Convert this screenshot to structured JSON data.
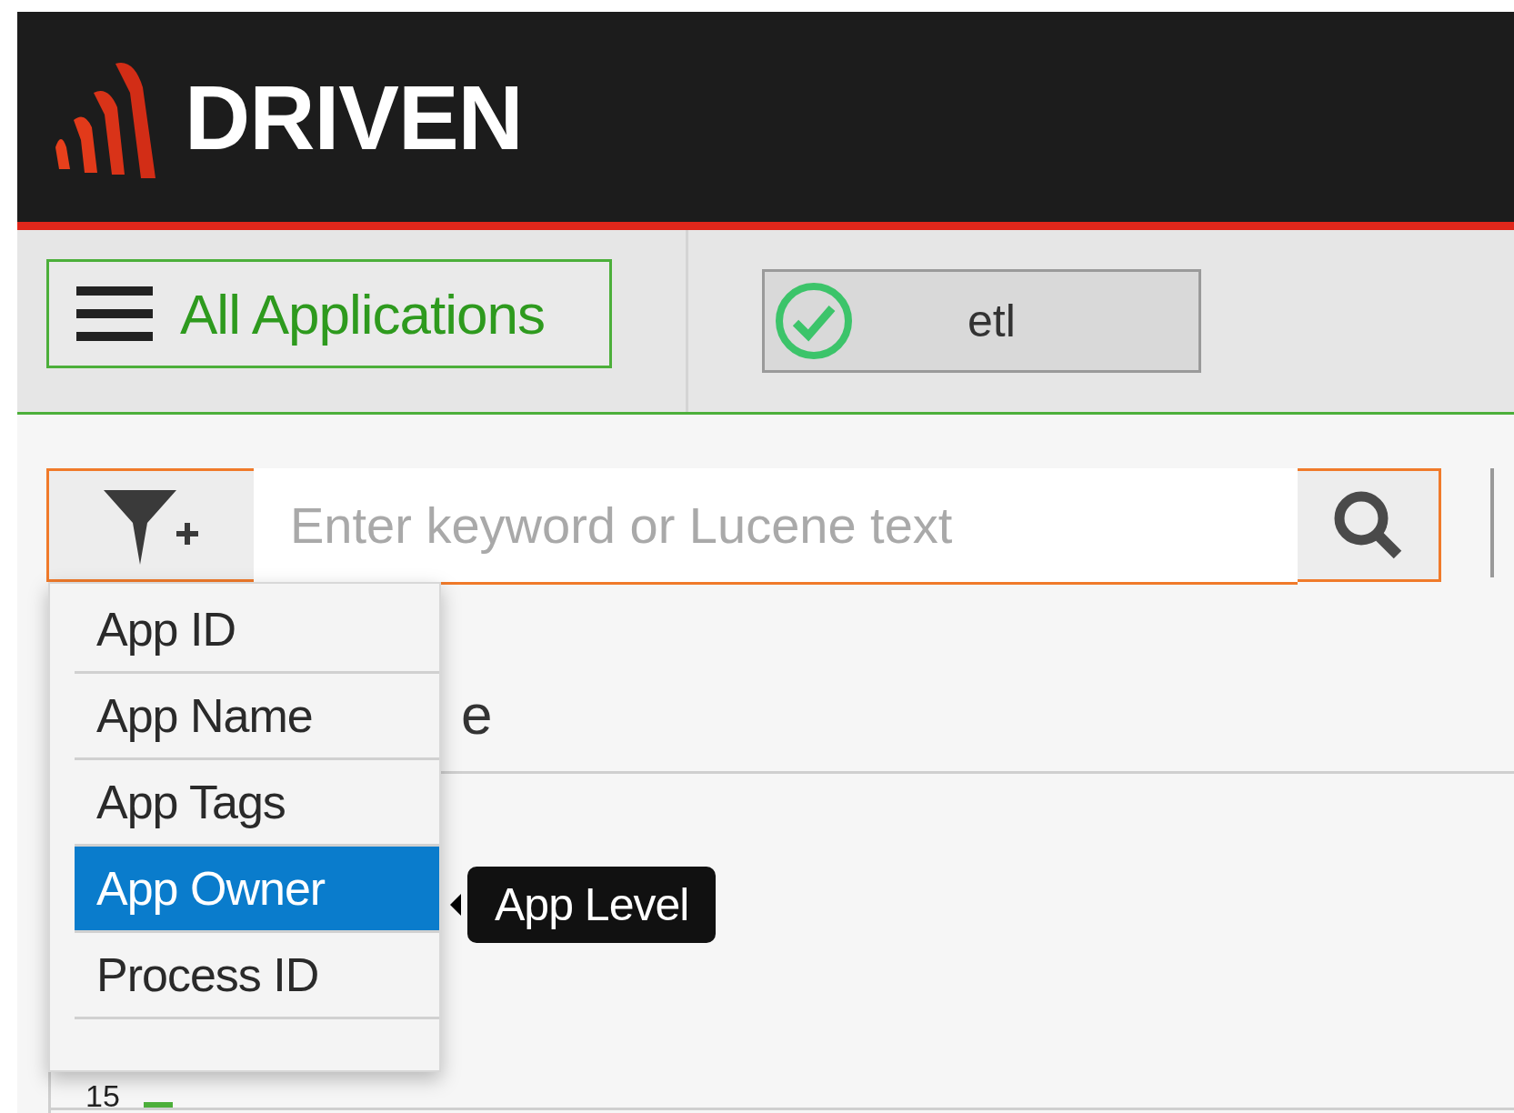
{
  "header": {
    "logo_text": "DRIVEN"
  },
  "toolbar": {
    "all_apps_button": {
      "label": "All Applications"
    },
    "status_chip": {
      "label": "etl"
    }
  },
  "search": {
    "placeholder": "Enter keyword or Lucene text"
  },
  "filter_menu": {
    "items": [
      {
        "label": "App ID",
        "selected": false
      },
      {
        "label": "App Name",
        "selected": false
      },
      {
        "label": "App Tags",
        "selected": false
      },
      {
        "label": "App Owner",
        "selected": true
      },
      {
        "label": "Process ID",
        "selected": false
      }
    ]
  },
  "tooltip": {
    "label": "App Level"
  },
  "content": {
    "heading_fragment": "e",
    "row_value": "15"
  }
}
